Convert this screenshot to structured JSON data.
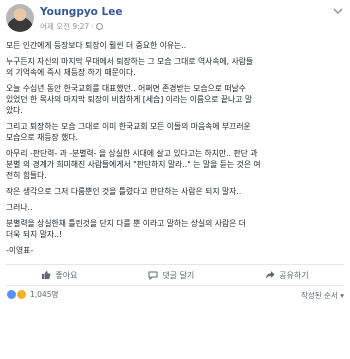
{
  "post": {
    "author": "Youngpyo Lee",
    "time": "어제 오전 9:27",
    "paragraphs": [
      [
        "모든 인간에게 등장보다 퇴장이 훨씬 더 중요한 이유는.."
      ],
      [
        "누구든지 자신의 마지막 무대에서 퇴장하는 그 모습 그대로 역사속에, 사람들",
        "의 기억속에 즉시 재등장 하기 때문이다."
      ],
      [
        "오늘 수십년 동안 한국교회를 대표했던.. 어쩌면 존경받는 모습으로 떠날수",
        "있었던 한 목사의 마지막 퇴장이 비참하게 [세습] 이라는 이름으로 끝나고 말",
        "았다."
      ],
      [
        "그리고 퇴장하는 모습 그대로 이미 한국교회 모든 이들의 마음속에 부끄러운",
        "모습으로 재등장 했다."
      ],
      [
        "아무리 -판단력- 과 -분별력- 을 상실한 시대에 살고 있다고는 하지만.. 판단 과",
        "분별 의 경계가 희미해진 사람들에게서 \"판단하지 말라..\" 는 말을 듣는 것은 여",
        "전히 힘들다."
      ],
      [
        "작은 생각으로 그저 다름뿐인 것을 틀렸다고 판단하는 사람은 되지 말자.."
      ],
      [
        "그러나.."
      ],
      [
        "분별력을 상실한채 틀린것을 단지 다를 뿐 이라고 말하는 상실의 사람은 더",
        "더욱 되지 말자..!"
      ],
      [
        "-이영표-"
      ]
    ]
  },
  "actions": {
    "like": "좋아요",
    "comment": "댓글 달기",
    "share": "공유하기"
  },
  "footer": {
    "reaction_count": "1,045명",
    "sort_label": "작성된 순서 ▾"
  },
  "colors": {
    "link": "#365899",
    "muted": "#90949c",
    "like": "#5890ff",
    "sad": "#f7b125"
  }
}
